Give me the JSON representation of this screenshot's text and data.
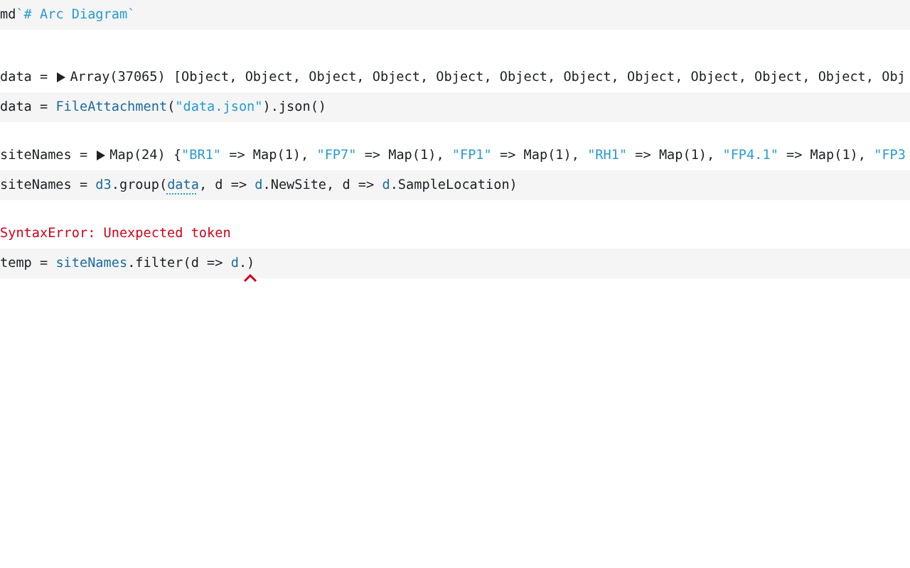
{
  "cells": [
    {
      "kind": "code",
      "tokens": [
        {
          "kind": "plain",
          "text": "md"
        },
        {
          "kind": "string",
          "text": "`# Arc Diagram`"
        }
      ]
    },
    {
      "kind": "output",
      "label": "data = ",
      "collapsed": true,
      "tokens": [
        {
          "kind": "plain",
          "text": "Array(37065) [Object, Object, Object, Object, Object, Object, Object, Object, Object, Object, Object, Obj"
        }
      ]
    },
    {
      "kind": "code",
      "tokens": [
        {
          "kind": "plain",
          "text": "data = "
        },
        {
          "kind": "ref",
          "text": "FileAttachment"
        },
        {
          "kind": "plain",
          "text": "("
        },
        {
          "kind": "string",
          "text": "\"data.json\""
        },
        {
          "kind": "plain",
          "text": ").json()"
        }
      ]
    },
    {
      "kind": "output",
      "label": "siteNames = ",
      "collapsed": true,
      "tokens": [
        {
          "kind": "plain",
          "text": "Map(24) {"
        },
        {
          "kind": "string",
          "text": "\"BR1\""
        },
        {
          "kind": "plain",
          "text": " => Map(1), "
        },
        {
          "kind": "string",
          "text": "\"FP7\""
        },
        {
          "kind": "plain",
          "text": " => Map(1), "
        },
        {
          "kind": "string",
          "text": "\"FP1\""
        },
        {
          "kind": "plain",
          "text": " => Map(1), "
        },
        {
          "kind": "string",
          "text": "\"RH1\""
        },
        {
          "kind": "plain",
          "text": " => Map(1), "
        },
        {
          "kind": "string",
          "text": "\"FP4.1\""
        },
        {
          "kind": "plain",
          "text": " => Map(1), "
        },
        {
          "kind": "string",
          "text": "\"FP3"
        }
      ]
    },
    {
      "kind": "code",
      "tokens": [
        {
          "kind": "plain",
          "text": "siteNames = "
        },
        {
          "kind": "ref",
          "text": "d3"
        },
        {
          "kind": "plain",
          "text": ".group("
        },
        {
          "kind": "marked",
          "text": "data"
        },
        {
          "kind": "plain",
          "text": ", d => "
        },
        {
          "kind": "ref",
          "text": "d"
        },
        {
          "kind": "plain",
          "text": ".NewSite, d => "
        },
        {
          "kind": "ref",
          "text": "d"
        },
        {
          "kind": "plain",
          "text": ".SampleLocation)"
        }
      ]
    },
    {
      "kind": "error",
      "text": "SyntaxError: Unexpected token"
    },
    {
      "kind": "code",
      "tokens": [
        {
          "kind": "plain",
          "text": "temp = "
        },
        {
          "kind": "ref",
          "text": "siteNames"
        },
        {
          "kind": "plain",
          "text": ".filter(d => "
        },
        {
          "kind": "ref",
          "text": "d"
        },
        {
          "kind": "plain",
          "text": "."
        },
        {
          "kind": "error",
          "text": ")"
        }
      ]
    }
  ]
}
